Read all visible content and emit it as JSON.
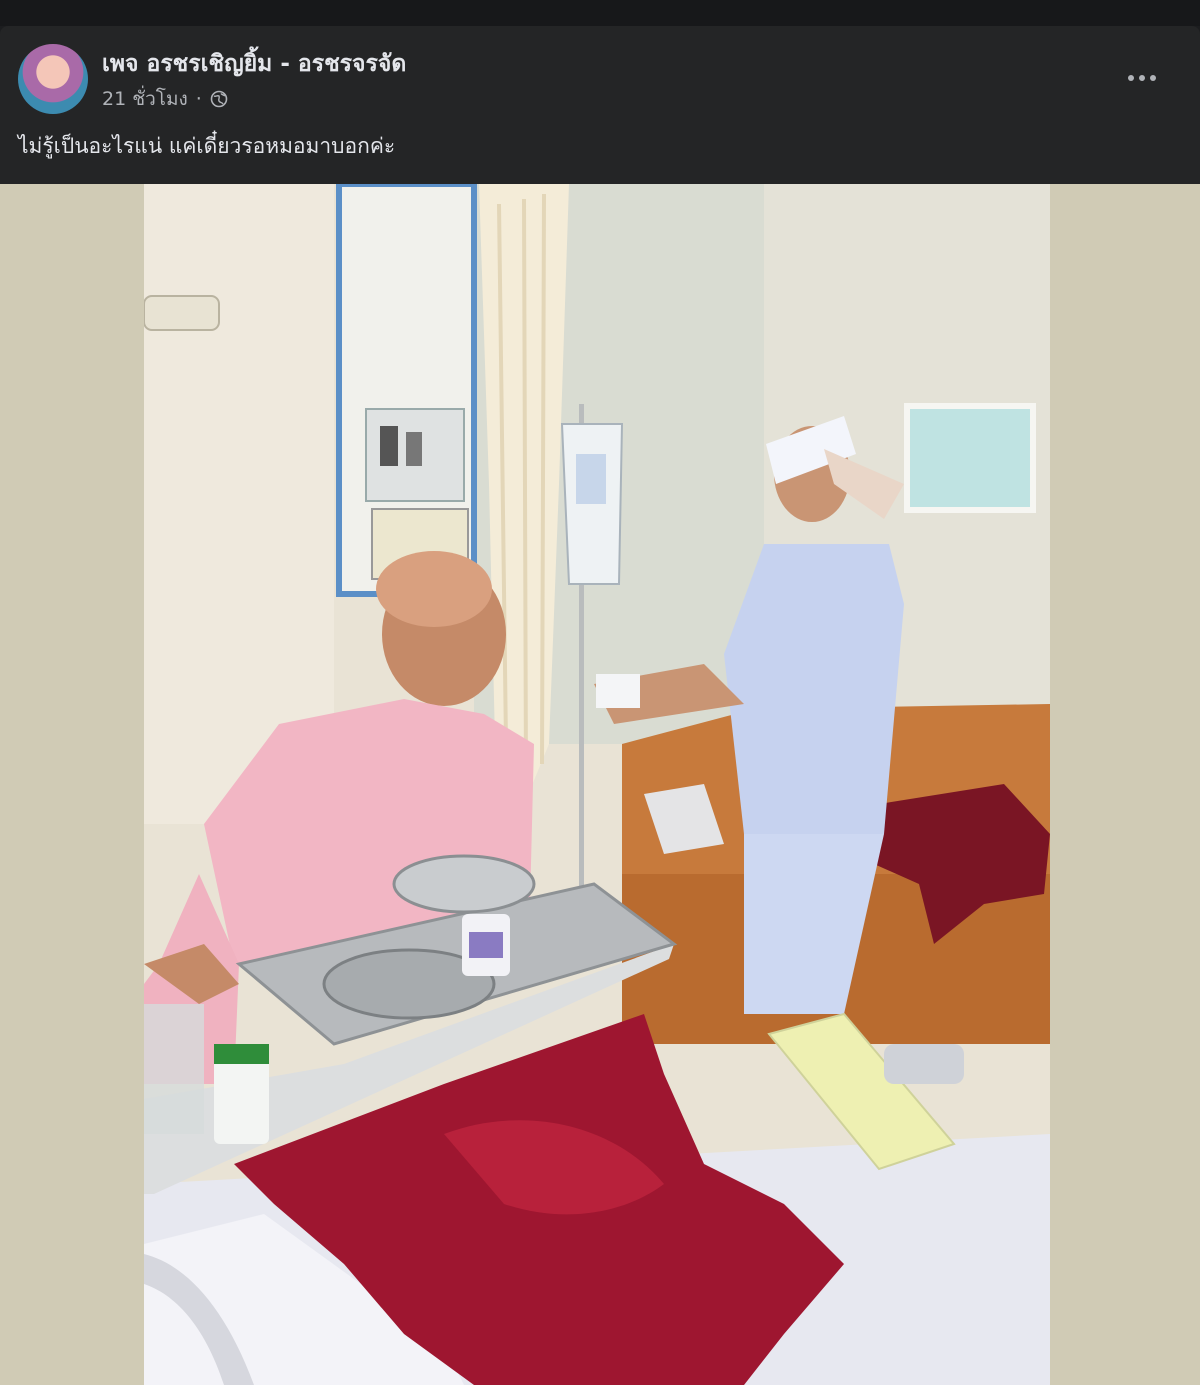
{
  "post": {
    "author_name": "เพจ อรชรเชิญยิ้ม - อรชรจรจัด",
    "timestamp": "21 ชั่วโมง",
    "separator": "·",
    "privacy_icon": "globe-icon",
    "more_icon": "more-options-icon",
    "caption": "ไม่รู้เป็นอะไรแน่ แค่เดี๋ยวรอหมอมาบอกค่ะ"
  },
  "colors": {
    "post_background": "#242526",
    "primary_text": "#e4e6eb",
    "secondary_text": "#b0b3b8",
    "media_letterbox": "#d0cbb5"
  }
}
